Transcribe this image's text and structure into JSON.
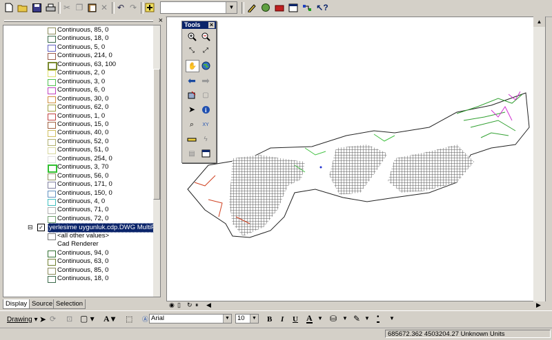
{
  "toolbar": {
    "icons": [
      "new-icon",
      "open-icon",
      "save-icon",
      "print-icon",
      "cut-icon",
      "copy-icon",
      "paste-icon",
      "delete-icon",
      "undo-icon",
      "redo-icon",
      "add-data-icon",
      "editor-icon",
      "arcmap-icon",
      "arctoolbox-icon",
      "window-icon",
      "model-icon",
      "whats-this-icon"
    ],
    "scale_value": ""
  },
  "toc": {
    "close_glyph": "×",
    "items_top": [
      {
        "label": "Continuous, 85, 0",
        "color": "#8a8a5a"
      },
      {
        "label": "Continuous, 18, 0",
        "color": "#3a6a4a"
      },
      {
        "label": "Continuous, 5, 0",
        "color": "#6060c0"
      },
      {
        "label": "Continuous, 214, 0",
        "color": "#9a5a4a"
      },
      {
        "label": "Continuous, 63, 100",
        "color": "#7a8a30"
      },
      {
        "label": "Continuous, 2, 0",
        "color": "#e0e070"
      },
      {
        "label": "Continuous, 3, 0",
        "color": "#50c050"
      },
      {
        "label": "Continuous, 6, 0",
        "color": "#c040c0"
      },
      {
        "label": "Continuous, 30, 0",
        "color": "#d09040"
      },
      {
        "label": "Continuous, 62, 0",
        "color": "#a0a040"
      },
      {
        "label": "Continuous, 1, 0",
        "color": "#c04040"
      },
      {
        "label": "Continuous, 15, 0",
        "color": "#a06040"
      },
      {
        "label": "Continuous, 40, 0",
        "color": "#d0c060"
      },
      {
        "label": "Continuous, 52, 0",
        "color": "#b0b070"
      },
      {
        "label": "Continuous, 51, 0",
        "color": "#d8d8a0"
      },
      {
        "label": "Continuous, 254, 0",
        "color": "#e0e0e0"
      },
      {
        "label": "Continuous, 3, 70",
        "color": "#30c030"
      },
      {
        "label": "Continuous, 56, 0",
        "color": "#909060"
      },
      {
        "label": "Continuous, 171, 0",
        "color": "#8080a0"
      },
      {
        "label": "Continuous, 150, 0",
        "color": "#6090c0"
      },
      {
        "label": "Continuous, 4, 0",
        "color": "#40c0c0"
      },
      {
        "label": "Continuous, 71, 0",
        "color": "#b0b0b0"
      },
      {
        "label": "Continuous, 72, 0",
        "color": "#70a070"
      }
    ],
    "layer": {
      "expand_glyph": "⊟",
      "check_glyph": "✓",
      "name": "yerlesime uygunluk.cdp.DWG MultiPatch",
      "other_values": "<all other values>",
      "renderer": "Cad Renderer"
    },
    "items_bottom": [
      {
        "label": "Continuous, 94, 0",
        "color": "#307030"
      },
      {
        "label": "Continuous, 63, 0",
        "color": "#708030"
      },
      {
        "label": "Continuous, 85, 0",
        "color": "#8a8a5a"
      },
      {
        "label": "Continuous, 18, 0",
        "color": "#3a6a4a"
      }
    ],
    "tabs": [
      "Display",
      "Source",
      "Selection"
    ]
  },
  "tools": {
    "title": "Tools",
    "close_glyph": "×",
    "buttons": [
      "zoom-in-icon",
      "zoom-out-icon",
      "fixed-zoom-in-icon",
      "fixed-zoom-out-icon",
      "pan-icon",
      "full-extent-icon",
      "back-extent-icon",
      "forward-extent-icon",
      "select-features-icon",
      "clear-selection-icon",
      "select-elements-icon",
      "identify-icon",
      "find-icon",
      "go-to-xy-icon",
      "measure-icon",
      "hyperlink-icon",
      "html-popup-icon",
      "time-slider-icon"
    ]
  },
  "drawing": {
    "menu_label": "Drawing",
    "font": "Arial",
    "font_size": "10",
    "bold": "B",
    "italic": "I",
    "underline": "U",
    "font_color_glyph": "A",
    "text_glyph": "A"
  },
  "status": {
    "coords": "685672.362  4503204.27 Unknown Units"
  },
  "colors": {
    "title_bar": "#0a246a",
    "chrome": "#d4d0c8",
    "selection": "#0a246a"
  }
}
